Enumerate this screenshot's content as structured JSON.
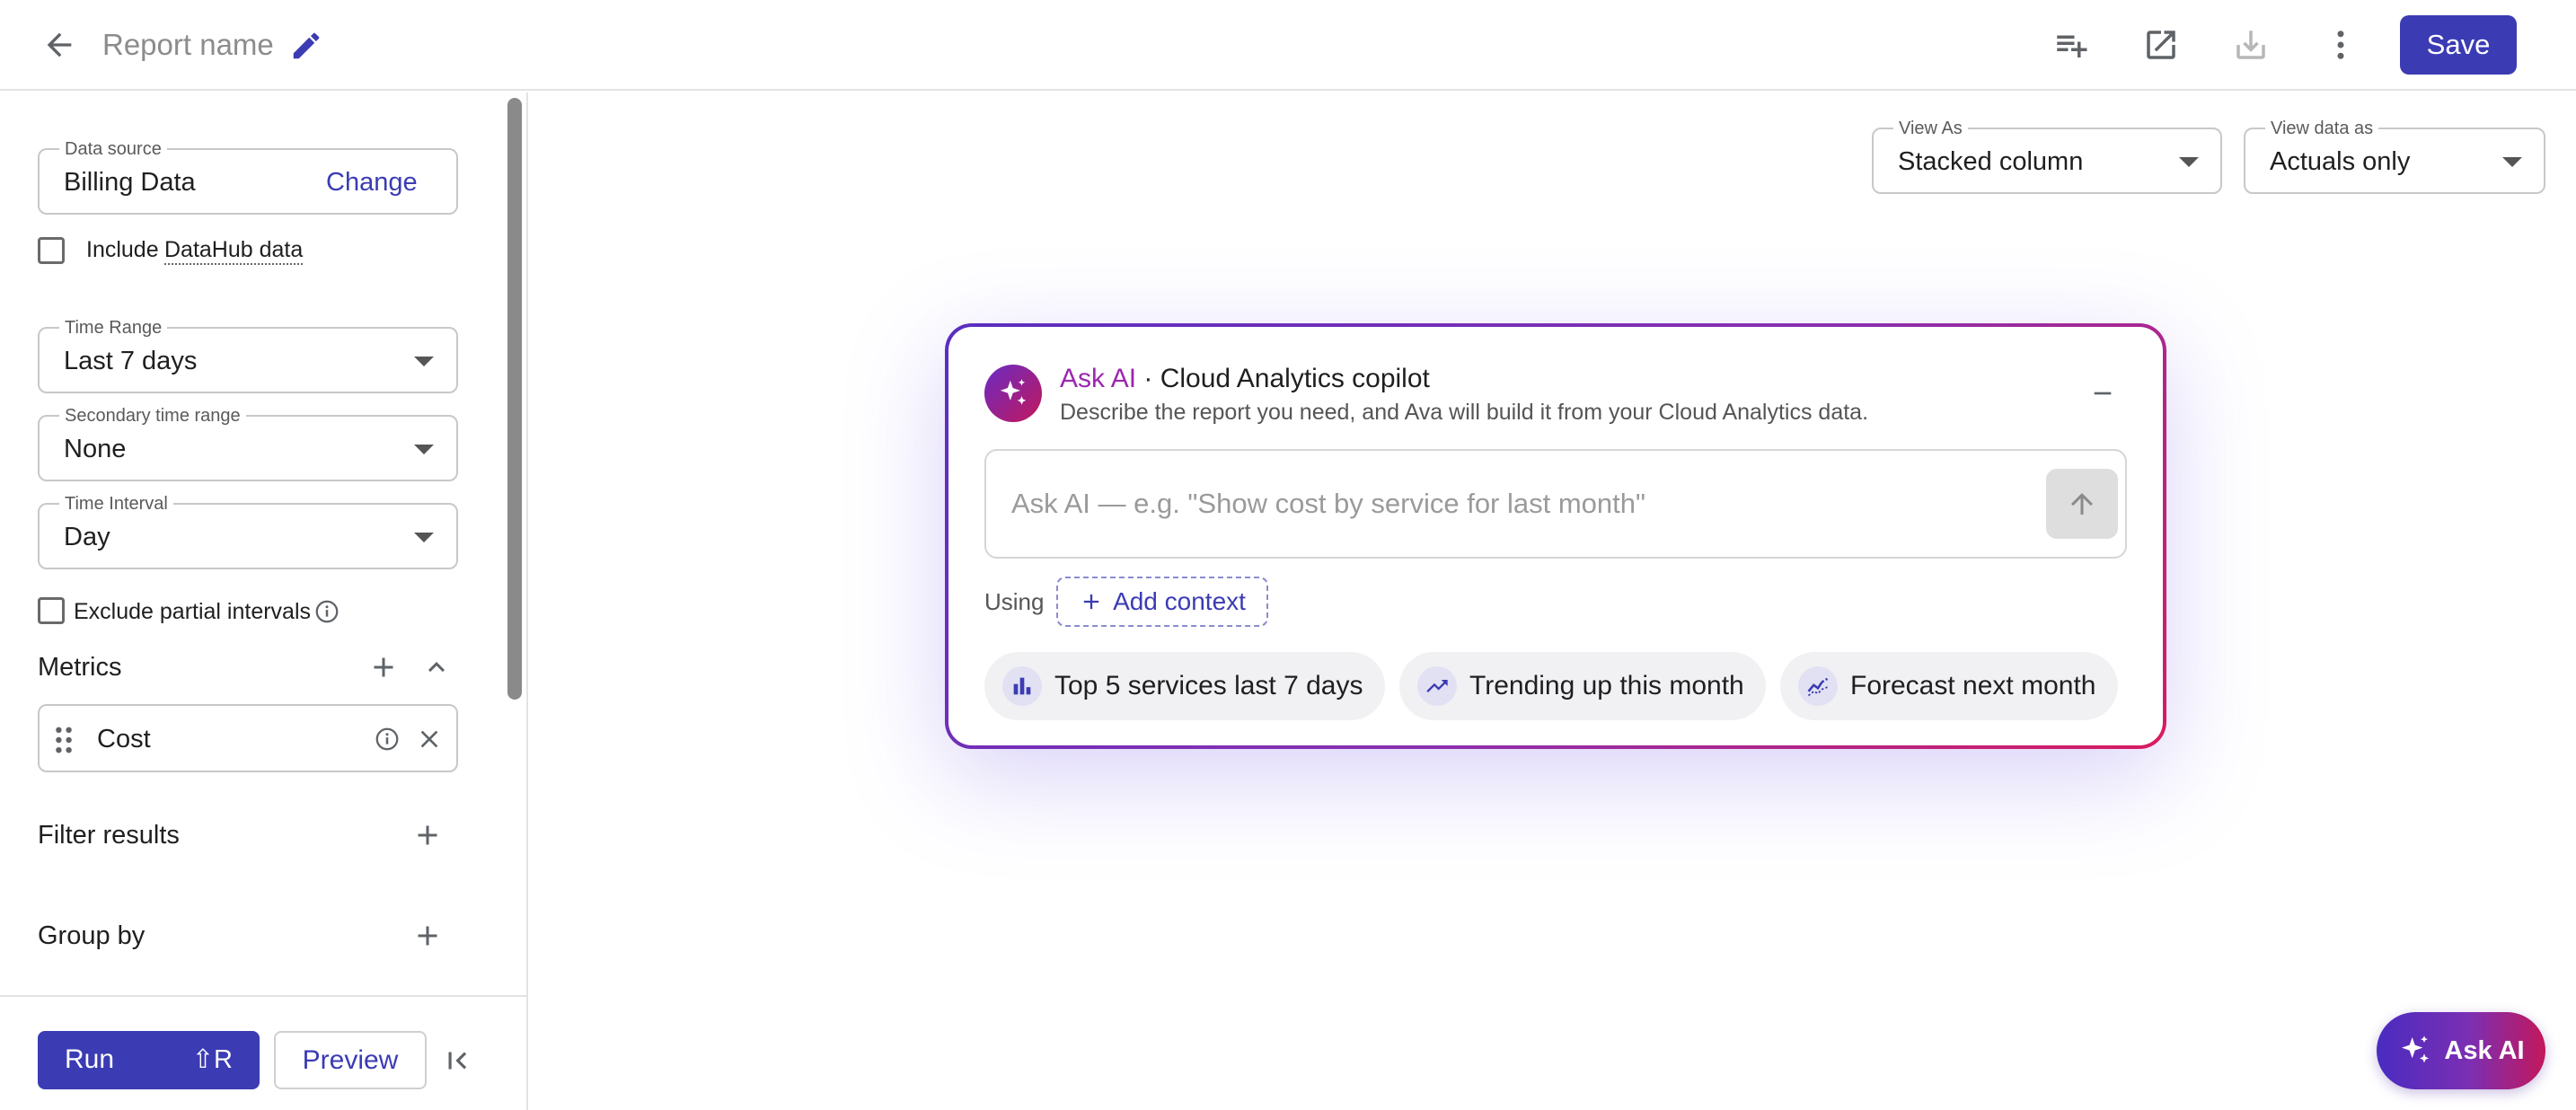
{
  "header": {
    "report_name": "Report name",
    "save_label": "Save",
    "icons": [
      "arrow-back-icon",
      "edit-pencil-icon",
      "add-to-dashboard-icon",
      "open-in-new-icon",
      "download-icon",
      "more-vert-icon"
    ]
  },
  "sidebar": {
    "data_source": {
      "label": "Data source",
      "value": "Billing Data",
      "change_label": "Change"
    },
    "include_datahub": {
      "text": "Include",
      "link": "DataHub data",
      "checked": false
    },
    "time_range": {
      "label": "Time Range",
      "value": "Last 7 days"
    },
    "secondary_time_range": {
      "label": "Secondary time range",
      "value": "None"
    },
    "time_interval": {
      "label": "Time Interval",
      "value": "Day"
    },
    "exclude_partial": {
      "label": "Exclude partial intervals",
      "checked": false
    },
    "metrics": {
      "title": "Metrics",
      "items": [
        {
          "label": "Cost"
        }
      ]
    },
    "filter_results": {
      "title": "Filter results"
    },
    "group_by": {
      "title": "Group by"
    },
    "run": {
      "label": "Run",
      "shortcut": "⇧R"
    },
    "preview_label": "Preview"
  },
  "main": {
    "view_as": {
      "label": "View As",
      "value": "Stacked column"
    },
    "view_data_as": {
      "label": "View data as",
      "value": "Actuals only"
    }
  },
  "copilot": {
    "title_accent": "Ask AI",
    "title_rest": " · Cloud Analytics copilot",
    "subtitle": "Describe the report you need, and Ava will build it from your Cloud Analytics data.",
    "input_placeholder": "Ask AI — e.g. \"Show cost by service for last month\"",
    "using_label": "Using",
    "add_context_label": "Add context",
    "suggestions": [
      {
        "label": "Top 5 services last 7 days",
        "icon": "bar-chart-icon"
      },
      {
        "label": "Trending up this month",
        "icon": "trending-up-icon"
      },
      {
        "label": "Forecast next month",
        "icon": "forecast-icon"
      }
    ]
  },
  "fab": {
    "label": "Ask AI"
  },
  "colors": {
    "primary": "#3b3bb4",
    "accent_purple": "#9c27b0",
    "accent_pink": "#d81b60"
  }
}
